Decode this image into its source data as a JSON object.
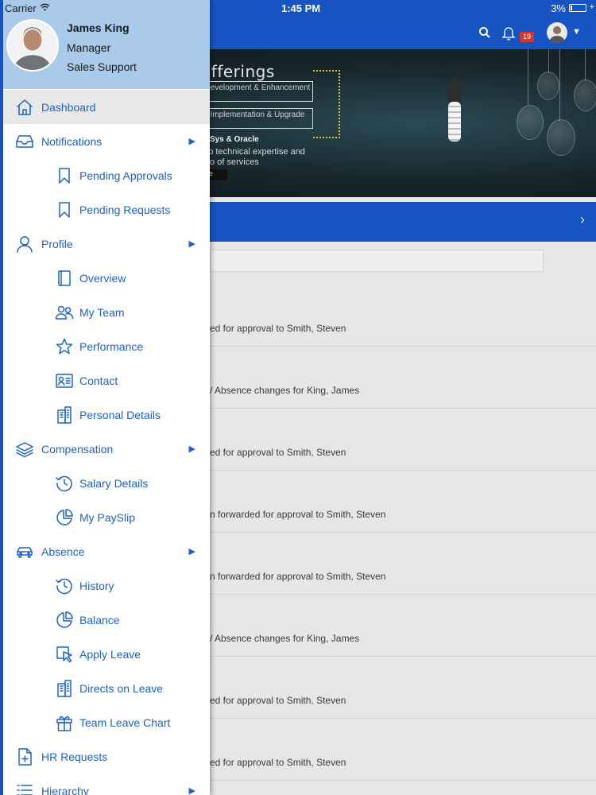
{
  "status_bar": {
    "carrier": "Carrier",
    "time": "1:45 PM",
    "battery": "3%"
  },
  "header": {
    "notification_count": "19"
  },
  "banner": {
    "title": "vice Offerings",
    "box1": "Development & Enhancement",
    "box2": "Implementation & Upgrade",
    "sub": "Sys & Oracle",
    "line1": "eep technical expertise and",
    "line2": "folio of services",
    "button": "re"
  },
  "feed": [
    "ed for approval to Smith, Steven",
    "/ Absence changes for King, James",
    "ed for approval to Smith, Steven",
    "n forwarded for approval to Smith, Steven",
    "n forwarded for approval to Smith, Steven",
    "/ Absence changes for King, James",
    "ed for approval to Smith, Steven",
    "ed for approval to Smith, Steven"
  ],
  "profile": {
    "name": "James King",
    "role": "Manager",
    "department": "Sales Support"
  },
  "menu": {
    "dashboard": "Dashboard",
    "notifications": "Notifications",
    "pending_approvals": "Pending Approvals",
    "pending_requests": "Pending Requests",
    "profile": "Profile",
    "overview": "Overview",
    "my_team": "My Team",
    "performance": "Performance",
    "contact": "Contact",
    "personal_details": "Personal Details",
    "compensation": "Compensation",
    "salary_details": "Salary Details",
    "my_payslip": "My PaySlip",
    "absence": "Absence",
    "history": "History",
    "balance": "Balance",
    "apply_leave": "Apply Leave",
    "directs_on_leave": "Directs on Leave",
    "team_leave_chart": "Team Leave Chart",
    "hr_requests": "HR Requests",
    "hierarchy": "Hierarchy"
  },
  "colors": {
    "primary": "#1554c1",
    "menu_text": "#1e63c4",
    "profile_bg": "#a9caeb",
    "badge": "#d9342b"
  }
}
